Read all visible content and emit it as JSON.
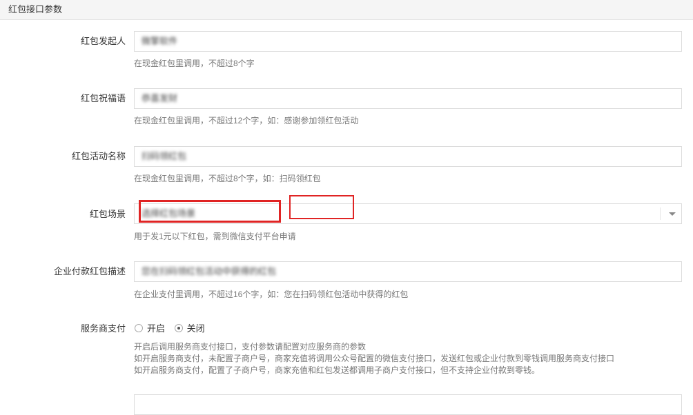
{
  "header": {
    "title": "红包接口参数"
  },
  "fields": {
    "sender": {
      "label": "红包发起人",
      "value": "微擎软件",
      "help": "在现金红包里调用，不超过8个字"
    },
    "wishing": {
      "label": "红包祝福语",
      "value": "恭喜发财",
      "help": "在现金红包里调用，不超过12个字，如：感谢参加领红包活动"
    },
    "activity": {
      "label": "红包活动名称",
      "value": "扫码领红包",
      "help": "在现金红包里调用，不超过8个字，如：扫码领红包"
    },
    "scene": {
      "label": "红包场景",
      "value": "选择红包场景",
      "help": "用于发1元以下红包，需到微信支付平台申请"
    },
    "enterprise_desc": {
      "label": "企业付款红包描述",
      "value": "您在扫码领红包活动中获得的红包",
      "help": "在企业支付里调用，不超过16个字，如：您在扫码领红包活动中获得的红包"
    },
    "service_pay": {
      "label": "服务商支付",
      "options": [
        "开启",
        "关闭"
      ],
      "selected": "关闭",
      "help_lines": [
        "开启后调用服务商支付接口，支付参数请配置对应服务商的参数",
        "如开启服务商支付，未配置子商户号，商家充值将调用公众号配置的微信支付接口，发送红包或企业付款到零钱调用服务商支付接口",
        "如开启服务商支付，配置了子商户号，商家充值和红包发送都调用子商户支付接口，但不支持企业付款到零钱。"
      ]
    }
  },
  "colors": {
    "highlight": "#e02424"
  }
}
